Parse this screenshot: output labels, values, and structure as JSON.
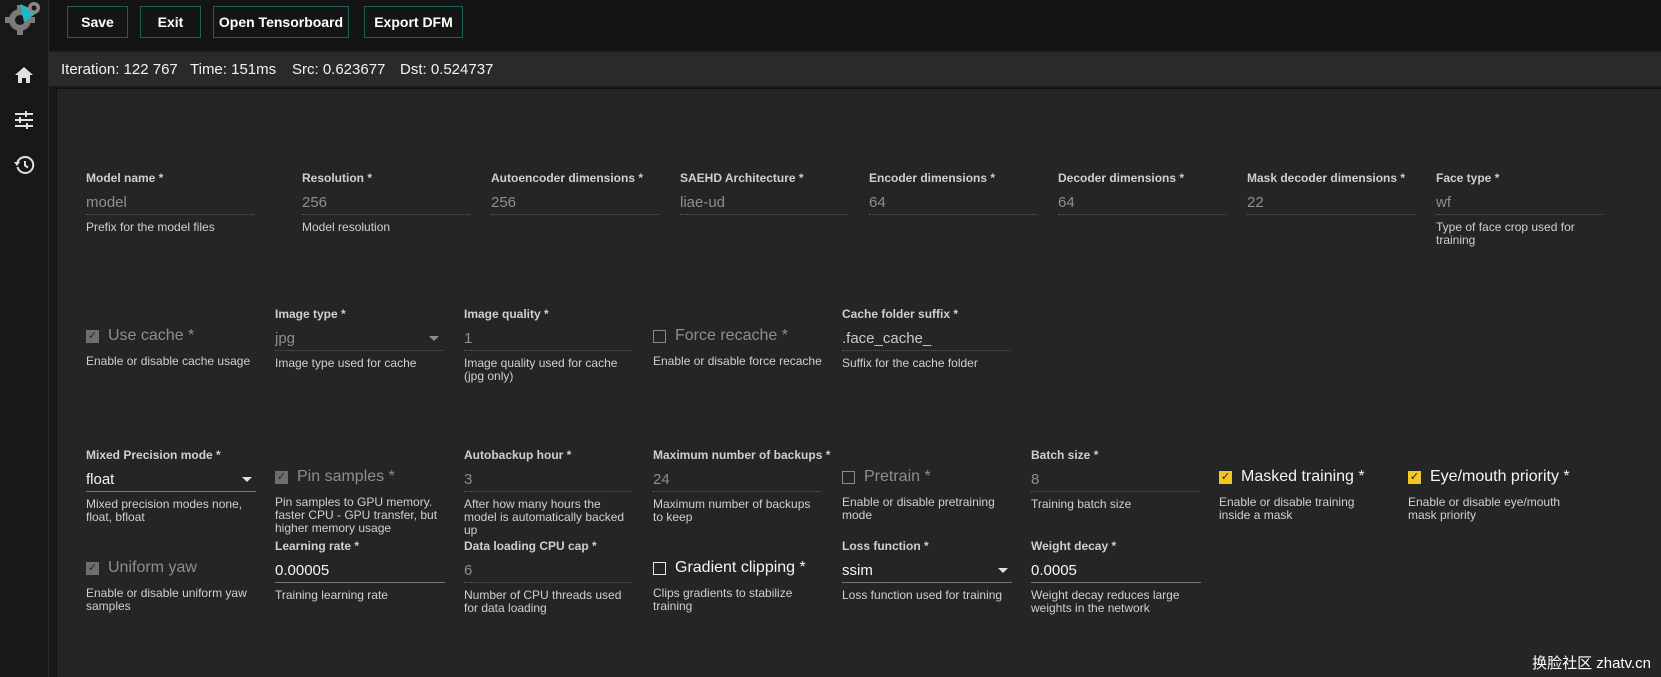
{
  "toolbar": {
    "save_label": "Save",
    "exit_label": "Exit",
    "tensorboard_label": "Open Tensorboard",
    "export_label": "Export DFM"
  },
  "status": {
    "iteration": "Iteration: 122 767",
    "time": "Time: 151ms",
    "src": "Src: 0.623677",
    "dst": "Dst: 0.524737"
  },
  "fields": {
    "model_name": {
      "label": "Model name *",
      "value": "model",
      "desc": "Prefix for the model files"
    },
    "resolution": {
      "label": "Resolution *",
      "value": "256",
      "desc": "Model resolution"
    },
    "ae_dims": {
      "label": "Autoencoder dimensions *",
      "value": "256"
    },
    "arch": {
      "label": "SAEHD Architecture *",
      "value": "liae-ud"
    },
    "enc_dims": {
      "label": "Encoder dimensions *",
      "value": "64"
    },
    "dec_dims": {
      "label": "Decoder dimensions *",
      "value": "64"
    },
    "mask_dec_dims": {
      "label": "Mask decoder dimensions *",
      "value": "22"
    },
    "face_type": {
      "label": "Face type *",
      "value": "wf",
      "desc": "Type of face crop used for training"
    },
    "image_type": {
      "label": "Image type *",
      "value": "jpg",
      "desc": "Image type used for cache"
    },
    "image_quality": {
      "label": "Image quality *",
      "value": "1",
      "desc": "Image quality used for cache (jpg only)"
    },
    "cache_suffix": {
      "label": "Cache folder suffix *",
      "value": ".face_cache_",
      "desc": "Suffix for the cache folder"
    },
    "mixed_precision": {
      "label": "Mixed Precision mode *",
      "value": "float",
      "desc": "Mixed precision modes none, float, bfloat"
    },
    "autobackup": {
      "label": "Autobackup hour *",
      "value": "3",
      "desc": "After how many hours the model is automatically backed up"
    },
    "max_backups": {
      "label": "Maximum number of backups *",
      "value": "24",
      "desc": "Maximum number of backups to keep"
    },
    "batch_size": {
      "label": "Batch size *",
      "value": "8",
      "desc": "Training batch size"
    },
    "learning_rate": {
      "label": "Learning rate *",
      "value": "0.00005",
      "desc": "Training learning rate"
    },
    "cpu_cap": {
      "label": "Data loading CPU cap *",
      "value": "6",
      "desc": "Number of CPU threads used for data loading"
    },
    "loss_function": {
      "label": "Loss function *",
      "value": "ssim",
      "desc": "Loss function used for training"
    },
    "weight_decay": {
      "label": "Weight decay *",
      "value": "0.0005",
      "desc": "Weight decay reduces large weights in the network"
    }
  },
  "checkboxes": {
    "use_cache": {
      "label": "Use cache *",
      "desc": "Enable or disable cache usage",
      "checked": true
    },
    "force_recache": {
      "label": "Force recache *",
      "desc": "Enable or disable force recache",
      "checked": false
    },
    "pin_samples": {
      "label": "Pin samples *",
      "desc": "Pin samples to GPU memory. faster CPU - GPU transfer, but higher memory usage",
      "checked": true
    },
    "pretrain": {
      "label": "Pretrain *",
      "desc": "Enable or disable pretraining mode",
      "checked": false
    },
    "masked_training": {
      "label": "Masked training *",
      "desc": "Enable or disable training inside a mask",
      "checked": true
    },
    "eye_mouth": {
      "label": "Eye/mouth priority *",
      "desc": "Enable or disable eye/mouth mask priority",
      "checked": true
    },
    "uniform_yaw": {
      "label": "Uniform yaw",
      "desc": "Enable or disable uniform yaw samples",
      "checked": true
    },
    "gradient_clipping": {
      "label": "Gradient clipping *",
      "desc": "Clips gradients to stabilize training",
      "checked": false
    }
  },
  "watermark": "换脸社区 zhatv.cn",
  "colors": {
    "accent_yellow": "#f3c623",
    "button_border": "#1f5f5a"
  }
}
